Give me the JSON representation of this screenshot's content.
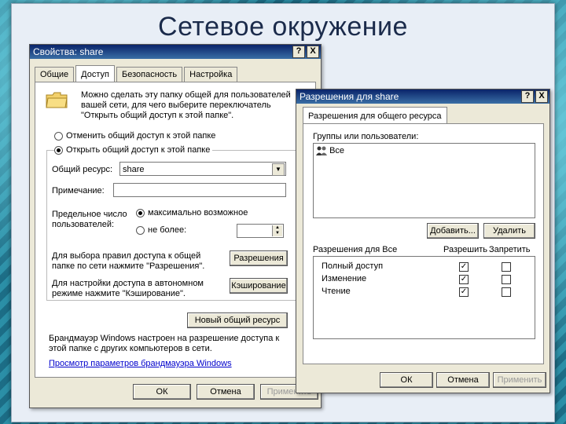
{
  "slide": {
    "title": "Сетевое окружение"
  },
  "props": {
    "title": "Свойства: share",
    "help_btn": "?",
    "close_btn": "X",
    "tabs": [
      "Общие",
      "Доступ",
      "Безопасность",
      "Настройка"
    ],
    "intro": "Можно сделать эту папку общей для пользователей вашей сети, для чего выберите переключатель \"Открыть общий доступ к этой папке\".",
    "radio_off": "Отменить общий доступ к этой папке",
    "radio_on": "Открыть общий доступ к этой папке",
    "share_label": "Общий ресурс:",
    "share_value": "share",
    "comment_label": "Примечание:",
    "limit_label": "Предельное число пользователей:",
    "limit_max": "максимально возможное",
    "limit_not_more": "не более:",
    "perm_text": "Для выбора правил доступа к общей папке по сети нажмите \"Разрешения\".",
    "perm_button": "Разрешения",
    "cache_text": "Для настройки доступа в автономном режиме нажмите \"Кэширование\".",
    "cache_button": "Кэширование",
    "new_share_button": "Новый общий ресурс",
    "firewall_text": "Брандмауэр Windows настроен на разрешение доступа к этой папке с других компьютеров в сети.",
    "firewall_link": "Просмотр параметров брандмауэра Windows",
    "ok": "ОК",
    "cancel": "Отмена",
    "apply": "Применить"
  },
  "perms": {
    "title": "Разрешения для share",
    "help_btn": "?",
    "close_btn": "X",
    "tab": "Разрешения для общего ресурса",
    "groups_label": "Группы или пользователи:",
    "users": [
      "Все"
    ],
    "add_button": "Добавить...",
    "remove_button": "Удалить",
    "perm_for_label": "Разрешения для Все",
    "allow_header": "Разрешить",
    "deny_header": "Запретить",
    "rows": [
      {
        "name": "Полный доступ",
        "allow": true,
        "deny": false
      },
      {
        "name": "Изменение",
        "allow": true,
        "deny": false
      },
      {
        "name": "Чтение",
        "allow": true,
        "deny": false
      }
    ],
    "ok": "ОК",
    "cancel": "Отмена",
    "apply": "Применить"
  }
}
